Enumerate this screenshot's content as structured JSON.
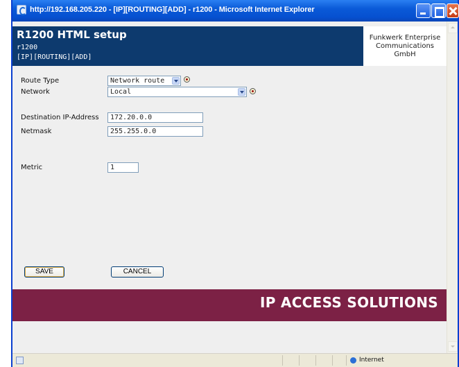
{
  "window": {
    "title": "http://192.168.205.220 - [IP][ROUTING][ADD] - r1200 - Microsoft Internet Explorer"
  },
  "header": {
    "title": "R1200 HTML setup",
    "device": "r1200",
    "path": "[IP][ROUTING][ADD]",
    "company_line1": "Funkwerk Enterprise",
    "company_line2": "Communications",
    "company_line3": "GmbH"
  },
  "form": {
    "route_type_label": "Route Type",
    "route_type_value": "Network route",
    "network_label": "Network",
    "network_value": "Local",
    "dest_ip_label": "Destination IP-Address",
    "dest_ip_value": "172.20.0.0",
    "netmask_label": "Netmask",
    "netmask_value": "255.255.0.0",
    "metric_label": "Metric",
    "metric_value": "1"
  },
  "buttons": {
    "save": "SAVE",
    "cancel": "CANCEL"
  },
  "footer": {
    "banner": "IP ACCESS SOLUTIONS"
  },
  "statusbar": {
    "zone": "Internet"
  },
  "colors": {
    "header_bg": "#0d3a6e",
    "footer_bg": "#7c2145",
    "page_bg": "#efefef"
  }
}
